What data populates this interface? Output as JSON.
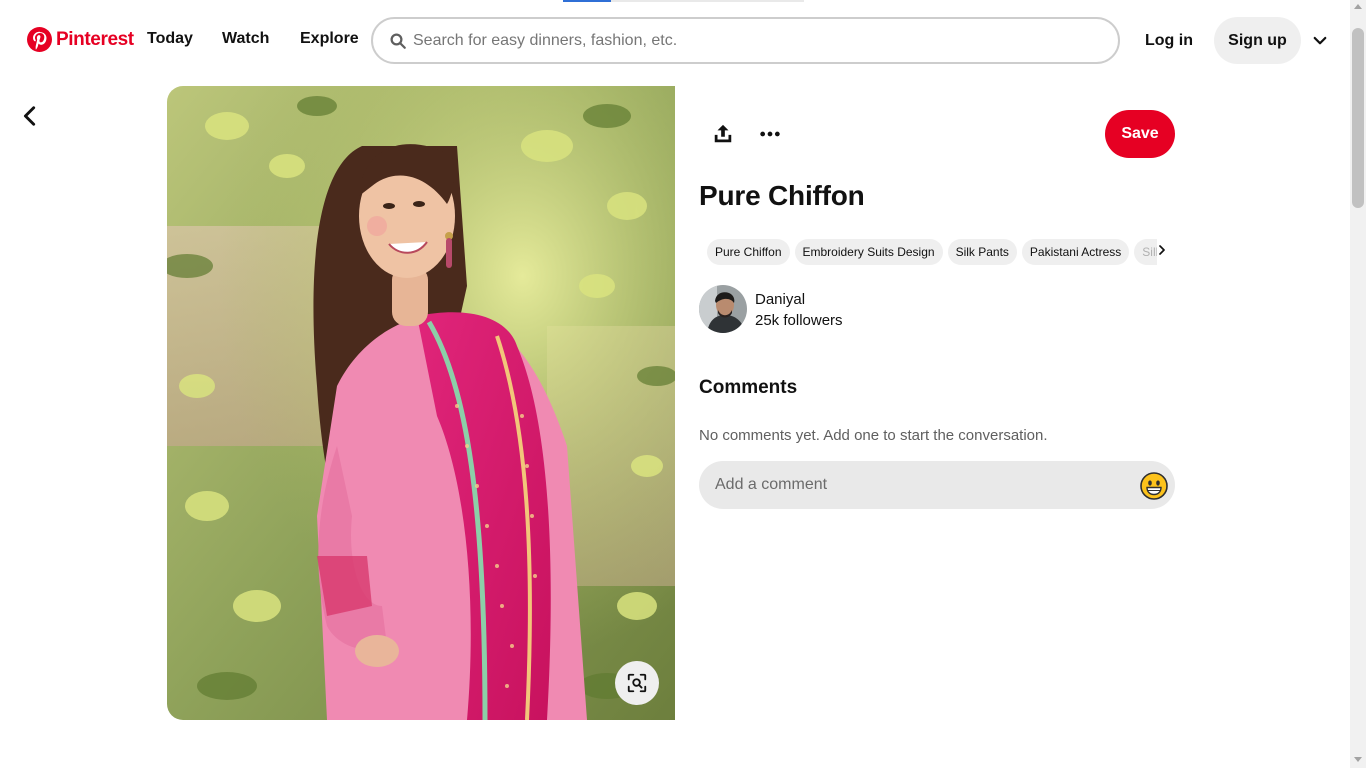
{
  "header": {
    "logo_text": "Pinterest",
    "nav": {
      "today": "Today",
      "watch": "Watch",
      "explore": "Explore"
    },
    "search_placeholder": "Search for easy dinners, fashion, etc.",
    "login_label": "Log in",
    "signup_label": "Sign up",
    "brand_color": "#e60023",
    "load_progress": 0.2
  },
  "pin": {
    "title": "Pure Chiffon",
    "save_label": "Save",
    "tags": [
      "Pure Chiffon",
      "Embroidery Suits Design",
      "Silk Pants",
      "Pakistani Actress",
      "Silk"
    ],
    "author": {
      "name": "Daniyal",
      "followers": "25k followers"
    }
  },
  "comments": {
    "heading": "Comments",
    "empty_text": "No comments yet. Add one to start the conversation.",
    "input_placeholder": "Add a comment"
  },
  "icons": [
    "pinterest-logo-icon",
    "search-icon",
    "chevron-down-icon",
    "back-arrow-icon",
    "share-icon",
    "more-options-icon",
    "visual-search-icon",
    "chevron-right-icon",
    "smiley-emoji-icon"
  ]
}
